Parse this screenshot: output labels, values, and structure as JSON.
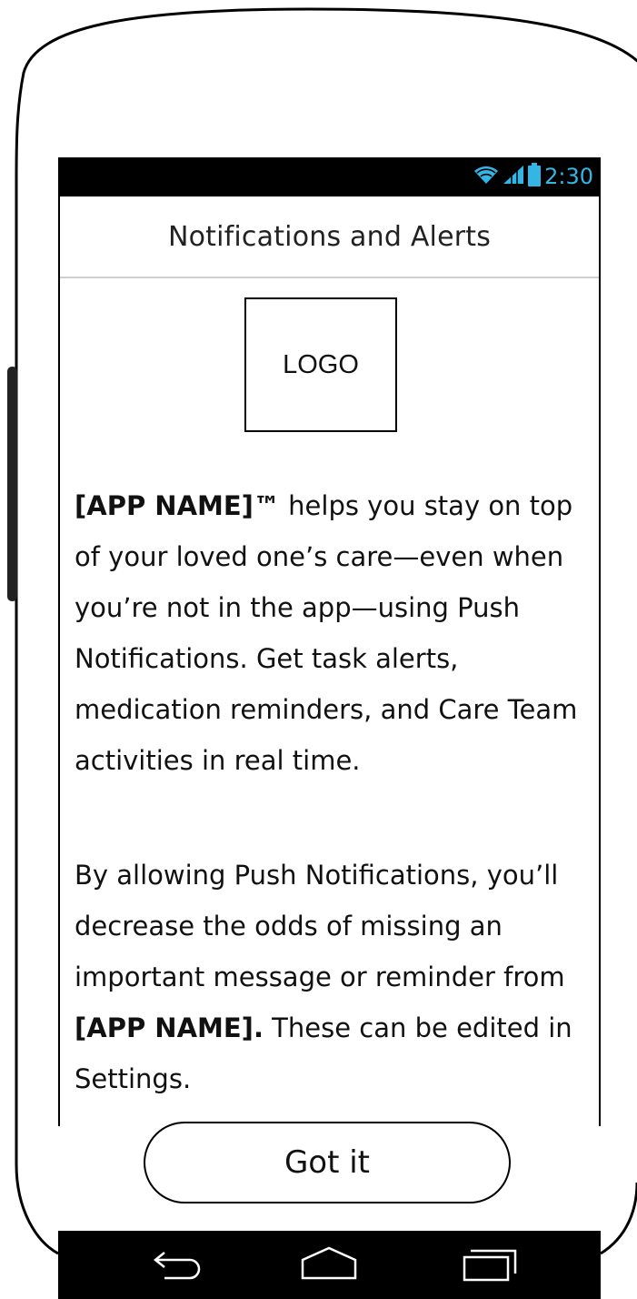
{
  "status_bar": {
    "time": "2:30",
    "icons": [
      "wifi-icon",
      "signal-icon",
      "battery-icon"
    ],
    "accent_color": "#33b5e5"
  },
  "header": {
    "title": "Notifications and Alerts"
  },
  "logo": {
    "label": "LOGO"
  },
  "body": {
    "para1": {
      "bold_lead": "[APP NAME]™",
      "text": " helps you stay on top of your loved one’s care—even when you’re not in the app—using Push Notifications. Get task alerts, medication reminders, and Care Team activities in real time."
    },
    "para2": {
      "text_before": "By allowing Push Notifications, you’ll decrease the odds of missing an important message or reminder from ",
      "bold": "[APP NAME].",
      "text_after": " These can be edited in Settings."
    }
  },
  "button": {
    "label": "Got it"
  },
  "nav_bar": {
    "buttons": [
      "back-icon",
      "home-icon",
      "recent-apps-icon"
    ]
  }
}
